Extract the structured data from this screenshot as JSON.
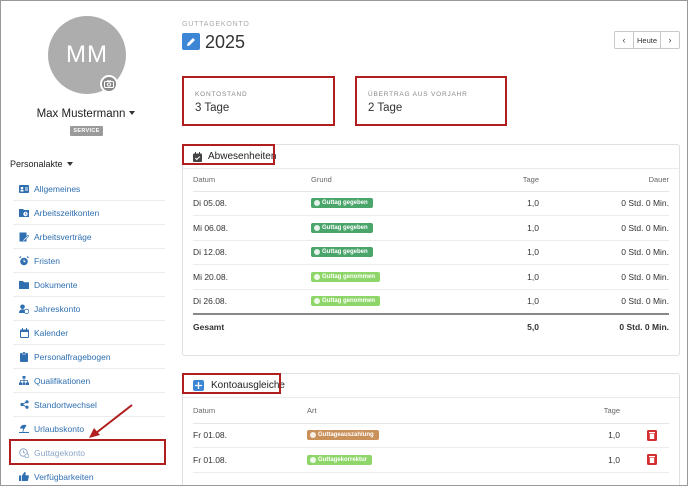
{
  "user": {
    "initials": "MM",
    "name": "Max Mustermann",
    "role": "SERVICE"
  },
  "sidebar": {
    "section_label": "Personalakte",
    "items": [
      {
        "label": "Allgemeines",
        "icon": "id-card-icon"
      },
      {
        "label": "Arbeitszeitkonten",
        "icon": "clock-folder-icon"
      },
      {
        "label": "Arbeitsverträge",
        "icon": "contract-icon"
      },
      {
        "label": "Fristen",
        "icon": "alarm-icon"
      },
      {
        "label": "Dokumente",
        "icon": "folder-icon"
      },
      {
        "label": "Jahreskonto",
        "icon": "user-clock-icon"
      },
      {
        "label": "Kalender",
        "icon": "calendar-icon"
      },
      {
        "label": "Personalfragebogen",
        "icon": "clipboard-icon"
      },
      {
        "label": "Qualifikationen",
        "icon": "sitemap-icon"
      },
      {
        "label": "Standortwechsel",
        "icon": "share-icon"
      },
      {
        "label": "Urlaubskonto",
        "icon": "umbrella-beach-icon"
      },
      {
        "label": "Guttagekonto",
        "icon": "clock-refresh-icon"
      },
      {
        "label": "Verfügbarkeiten",
        "icon": "thumbs-up-icon"
      }
    ],
    "active_index": 11
  },
  "header": {
    "eyebrow": "GUTTAGEKONTO",
    "year": "2025",
    "today_label": "Heute",
    "prev_label": "‹",
    "next_label": "›"
  },
  "stats": {
    "balance_label": "KONTOSTAND",
    "balance_value": "3 Tage",
    "carryover_label": "ÜBERTRAG AUS VORJAHR",
    "carryover_value": "2 Tage"
  },
  "absences": {
    "title": "Abwesenheiten",
    "columns": [
      "Datum",
      "Grund",
      "Tage",
      "Dauer"
    ],
    "rows": [
      {
        "date": "Di 05.08.",
        "reason": "Guttag gegeben",
        "reason_color": "#4aa56a",
        "days": "1,0",
        "duration": "0 Std. 0 Min."
      },
      {
        "date": "Mi 06.08.",
        "reason": "Guttag gegeben",
        "reason_color": "#4aa56a",
        "days": "1,0",
        "duration": "0 Std. 0 Min."
      },
      {
        "date": "Di 12.08.",
        "reason": "Guttag gegeben",
        "reason_color": "#4aa56a",
        "days": "1,0",
        "duration": "0 Std. 0 Min."
      },
      {
        "date": "Mi 20.08.",
        "reason": "Guttag genommen",
        "reason_color": "#8fd66a",
        "days": "1,0",
        "duration": "0 Std. 0 Min."
      },
      {
        "date": "Di 26.08.",
        "reason": "Guttag genommen",
        "reason_color": "#8fd66a",
        "days": "1,0",
        "duration": "0 Std. 0 Min."
      }
    ],
    "total": {
      "label": "Gesamt",
      "days": "5,0",
      "duration": "0 Std. 0 Min."
    }
  },
  "adjustments": {
    "title": "Kontoausgleiche",
    "columns": [
      "Datum",
      "Art",
      "Tage"
    ],
    "rows": [
      {
        "date": "Fr 01.08.",
        "type": "Guttageauszahlung",
        "type_color": "#c9905a",
        "days": "1,0"
      },
      {
        "date": "Fr 01.08.",
        "type": "Guttagekorrektur",
        "type_color": "#8fd66a",
        "days": "1,0"
      }
    ]
  },
  "colors": {
    "accent": "#3d86d6",
    "link": "#2f6fb0",
    "highlight": "#b01e1e",
    "delete": "#d42f2f"
  }
}
